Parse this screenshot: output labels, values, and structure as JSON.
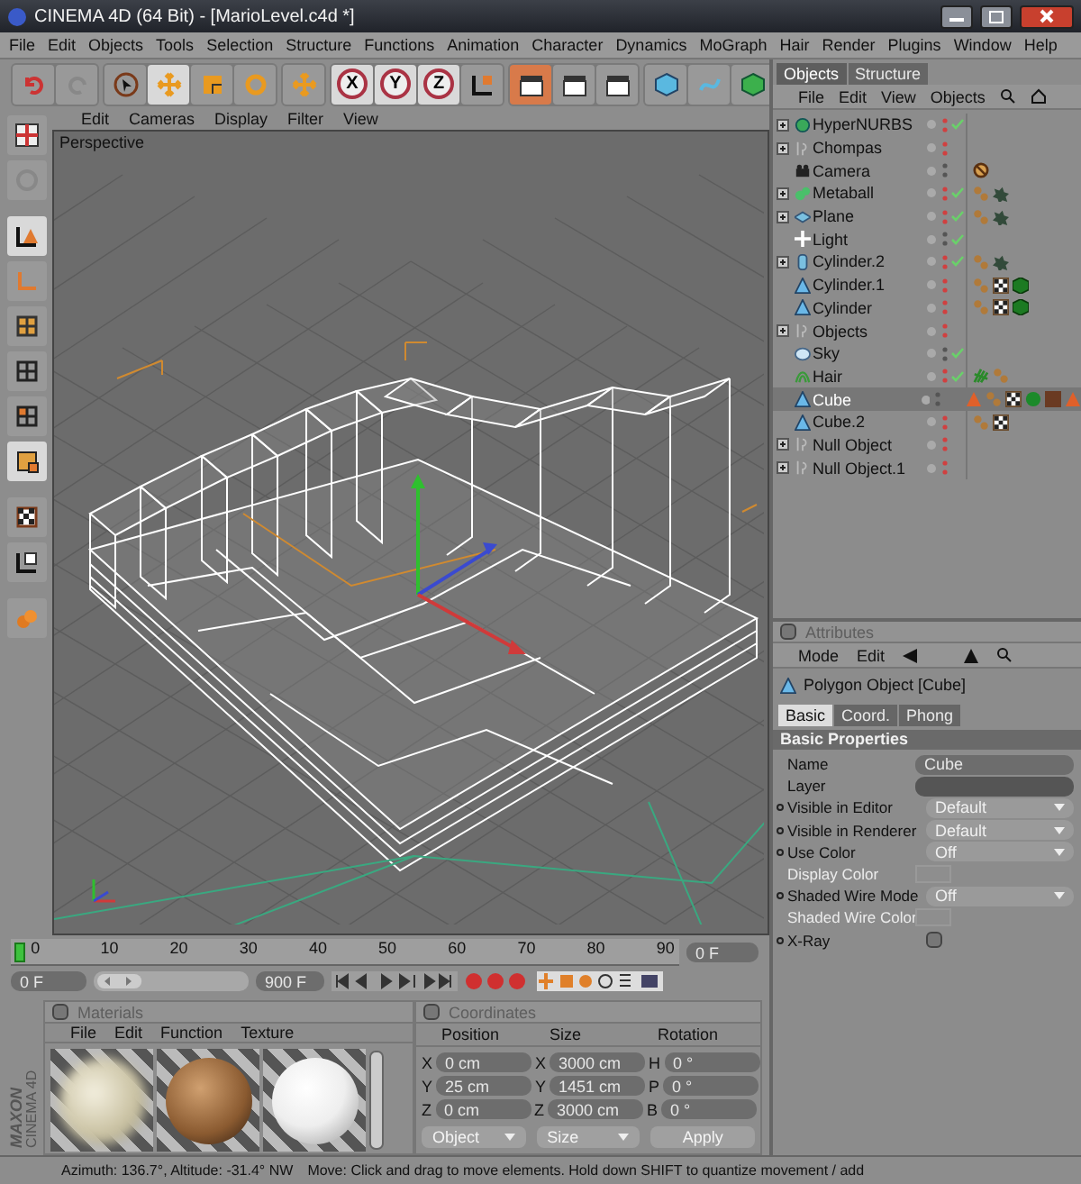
{
  "window": {
    "title": "CINEMA 4D (64 Bit) - [MarioLevel.c4d *]"
  },
  "menu": [
    "File",
    "Edit",
    "Objects",
    "Tools",
    "Selection",
    "Structure",
    "Functions",
    "Animation",
    "Character",
    "Dynamics",
    "MoGraph",
    "Hair",
    "Render",
    "Plugins",
    "Window",
    "Help"
  ],
  "axis_buttons": [
    {
      "label": "X",
      "selected": true
    },
    {
      "label": "Y",
      "selected": true
    },
    {
      "label": "Z",
      "selected": true
    }
  ],
  "viewport": {
    "menu": [
      "Edit",
      "Cameras",
      "Display",
      "Filter",
      "View"
    ],
    "label": "Perspective"
  },
  "timeline": {
    "ticks": [
      "0",
      "10",
      "20",
      "30",
      "40",
      "50",
      "60",
      "70",
      "80",
      "90"
    ],
    "playhead": {
      "level": 0
    },
    "current_frame": "0 F",
    "range_slider": {
      "level": 0.3
    },
    "start": "0 F",
    "end": "900 F"
  },
  "materials": {
    "title": "Materials",
    "menu": [
      "File",
      "Edit",
      "Function",
      "Texture"
    ],
    "swatches": [
      {
        "kind": "cloudy"
      },
      {
        "kind": "bronze"
      },
      {
        "kind": "white"
      }
    ]
  },
  "coordinates": {
    "title": "Coordinates",
    "headers": [
      "Position",
      "Size",
      "Rotation"
    ],
    "rows": [
      {
        "cells": [
          {
            "axis": "X",
            "value": "0 cm"
          },
          {
            "axis": "X",
            "value": "3000 cm"
          },
          {
            "axis": "H",
            "value": "0 °"
          }
        ]
      },
      {
        "cells": [
          {
            "axis": "Y",
            "value": "25 cm"
          },
          {
            "axis": "Y",
            "value": "1451 cm"
          },
          {
            "axis": "P",
            "value": "0 °"
          }
        ]
      },
      {
        "cells": [
          {
            "axis": "Z",
            "value": "0 cm"
          },
          {
            "axis": "Z",
            "value": "3000 cm"
          },
          {
            "axis": "B",
            "value": "0 °"
          }
        ]
      }
    ],
    "dropdowns": [
      "Object",
      "Size"
    ],
    "apply": "Apply"
  },
  "logo": {
    "brand": "MAXON",
    "product": "CINEMA 4D"
  },
  "status_bar": {
    "view": "Azimuth: 136.7°, Altitude: -31.4°  NW",
    "hint": "Move: Click and drag to move elements. Hold down SHIFT to quantize movement / add"
  },
  "objects_panel": {
    "tabs": [
      {
        "label": "Objects",
        "selected": true
      },
      {
        "label": "Structure",
        "selected": false
      }
    ],
    "menu": [
      "File",
      "Edit",
      "View",
      "Objects"
    ],
    "items": [
      {
        "name": "HyperNURBS",
        "kind": "nurbs",
        "expandable": true,
        "hidden": true,
        "enabled": true,
        "selected": false
      },
      {
        "name": "Chompas",
        "kind": "null",
        "expandable": true,
        "hidden": true,
        "enabled": false,
        "selected": false
      },
      {
        "name": "Camera",
        "kind": "camera",
        "expandable": false,
        "hidden": false,
        "enabled": false,
        "selected": false,
        "tags": [
          {
            "kind": "protection"
          }
        ]
      },
      {
        "name": "Metaball",
        "kind": "metaball",
        "expandable": true,
        "hidden": true,
        "enabled": true,
        "selected": false,
        "tags": [
          {
            "kind": "phong"
          },
          {
            "kind": "display"
          }
        ]
      },
      {
        "name": "Plane",
        "kind": "plane",
        "expandable": true,
        "hidden": true,
        "enabled": true,
        "selected": false,
        "tags": [
          {
            "kind": "phong"
          },
          {
            "kind": "display"
          }
        ]
      },
      {
        "name": "Light",
        "kind": "light",
        "expandable": false,
        "hidden": false,
        "enabled": true,
        "selected": false
      },
      {
        "name": "Cylinder.2",
        "kind": "cylinder",
        "expandable": true,
        "hidden": true,
        "enabled": true,
        "selected": false,
        "tags": [
          {
            "kind": "phong"
          },
          {
            "kind": "display"
          }
        ]
      },
      {
        "name": "Cylinder.1",
        "kind": "polygon",
        "expandable": false,
        "hidden": true,
        "enabled": false,
        "selected": false,
        "tags": [
          {
            "kind": "phong"
          },
          {
            "kind": "texture"
          },
          {
            "kind": "cube"
          }
        ]
      },
      {
        "name": "Cylinder",
        "kind": "polygon",
        "expandable": false,
        "hidden": true,
        "enabled": false,
        "selected": false,
        "tags": [
          {
            "kind": "phong"
          },
          {
            "kind": "texture"
          },
          {
            "kind": "cube"
          }
        ]
      },
      {
        "name": "Objects",
        "kind": "null",
        "expandable": true,
        "hidden": true,
        "enabled": false,
        "selected": false
      },
      {
        "name": "Sky",
        "kind": "sky",
        "expandable": false,
        "hidden": false,
        "enabled": true,
        "selected": false
      },
      {
        "name": "Hair",
        "kind": "hair",
        "expandable": false,
        "hidden": true,
        "enabled": true,
        "selected": false,
        "tags": [
          {
            "kind": "hair"
          },
          {
            "kind": "phong"
          }
        ]
      },
      {
        "name": "Cube",
        "kind": "polygon",
        "expandable": false,
        "hidden": false,
        "enabled": false,
        "selected": true,
        "tags": [
          {
            "kind": "warning"
          },
          {
            "kind": "phong"
          },
          {
            "kind": "texture"
          },
          {
            "kind": "sphere"
          },
          {
            "kind": "brown"
          },
          {
            "kind": "warning"
          }
        ]
      },
      {
        "name": "Cube.2",
        "kind": "polygon",
        "expandable": false,
        "hidden": true,
        "enabled": false,
        "selected": false,
        "tags": [
          {
            "kind": "phong"
          },
          {
            "kind": "texture"
          }
        ]
      },
      {
        "name": "Null Object",
        "kind": "null",
        "expandable": true,
        "hidden": true,
        "enabled": false,
        "selected": false
      },
      {
        "name": "Null Object.1",
        "kind": "null",
        "expandable": true,
        "hidden": true,
        "enabled": false,
        "selected": false
      }
    ]
  },
  "attributes": {
    "title": "Attributes",
    "menu": [
      "Mode",
      "Edit"
    ],
    "object": "Polygon Object [Cube]",
    "tabs": [
      {
        "label": "Basic",
        "selected": true
      },
      {
        "label": "Coord.",
        "selected": false
      },
      {
        "label": "Phong",
        "selected": false
      }
    ],
    "section": "Basic Properties",
    "fields": [
      {
        "label": "Name",
        "kind": "text",
        "value": "Cube",
        "animatable": false,
        "disabled": false
      },
      {
        "label": "Layer",
        "kind": "layer",
        "animatable": false,
        "disabled": false
      },
      {
        "label": "Visible in Editor",
        "kind": "dropdown",
        "value": "Default",
        "animatable": true,
        "disabled": false
      },
      {
        "label": "Visible in Renderer",
        "kind": "dropdown",
        "value": "Default",
        "animatable": true,
        "disabled": false
      },
      {
        "label": "Use Color",
        "kind": "dropdown",
        "value": "Off",
        "animatable": true,
        "disabled": false
      },
      {
        "label": "Display Color",
        "kind": "color",
        "animatable": false,
        "disabled": true
      },
      {
        "label": "Shaded Wire Mode",
        "kind": "dropdown",
        "value": "Off",
        "animatable": true,
        "disabled": false
      },
      {
        "label": "Shaded Wire Color",
        "kind": "color",
        "animatable": false,
        "disabled": true
      },
      {
        "label": "X-Ray",
        "kind": "checkbox",
        "checked": false,
        "animatable": true,
        "disabled": false
      }
    ]
  }
}
